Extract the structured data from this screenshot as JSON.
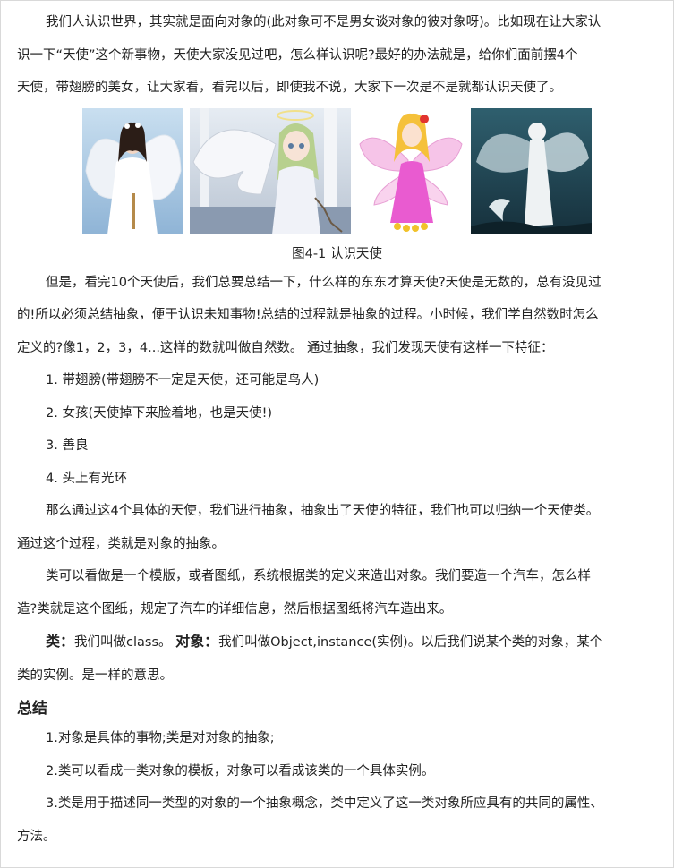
{
  "intro": {
    "line1": "我们人认识世界，其实就是面向对象的(此对象可不是男女谈对象的彼对象呀)。比如现在让大家认",
    "line2": "识一下“天使”这个新事物，天使大家没见过吧，怎么样认识呢?最好的办法就是，给你们面前摆4个",
    "line3": "天使，带翅膀的美女，让大家看，看完以后，即使我不说，大家下一次是不是就都认识天使了。"
  },
  "figure": {
    "caption": "图4-1 认识天使",
    "images": [
      "angel-photo-1",
      "angel-anime-2",
      "angel-cartoon-3",
      "angel-art-4"
    ]
  },
  "abstraction": {
    "line1": "但是，看完10个天使后，我们总要总结一下，什么样的东东才算天使?天使是无数的，总有没见过",
    "line2": "的!所以必须总结抽象，便于认识未知事物!总结的过程就是抽象的过程。小时候，我们学自然数时怎么",
    "line3": "定义的?像1，2，3，4...这样的数就叫做自然数。 通过抽象，我们发现天使有这样一下特征："
  },
  "features": [
    "1. 带翅膀(带翅膀不一定是天使，还可能是鸟人)",
    "2. 女孩(天使掉下来脸着地，也是天使!)",
    "3. 善良",
    "4. 头上有光环"
  ],
  "conclusion": {
    "line1": "那么通过这4个具体的天使，我们进行抽象，抽象出了天使的特征，我们也可以归纳一个天使类。",
    "line2": "通过这个过程，类就是对象的抽象。"
  },
  "template": {
    "line1": "类可以看做是一个模版，或者图纸，系统根据类的定义来造出对象。我们要造一个汽车，怎么样",
    "line2": "造?类就是这个图纸，规定了汽车的详细信息，然后根据图纸将汽车造出来。"
  },
  "terms": {
    "class_label": "类：",
    "class_text": "我们叫做class。",
    "object_label": "对象：",
    "object_text": "我们叫做Object,instance(实例)。以后我们说某个类的对象，某个",
    "line2": "类的实例。是一样的意思。"
  },
  "summary": {
    "heading": "总结",
    "item1": "1.对象是具体的事物;类是对对象的抽象;",
    "item2": "2.类可以看成一类对象的模板，对象可以看成该类的一个具体实例。",
    "item3_line1": "3.类是用于描述同一类型的对象的一个抽象概念，类中定义了这一类对象所应具有的共同的属性、",
    "item3_line2": "方法。"
  }
}
